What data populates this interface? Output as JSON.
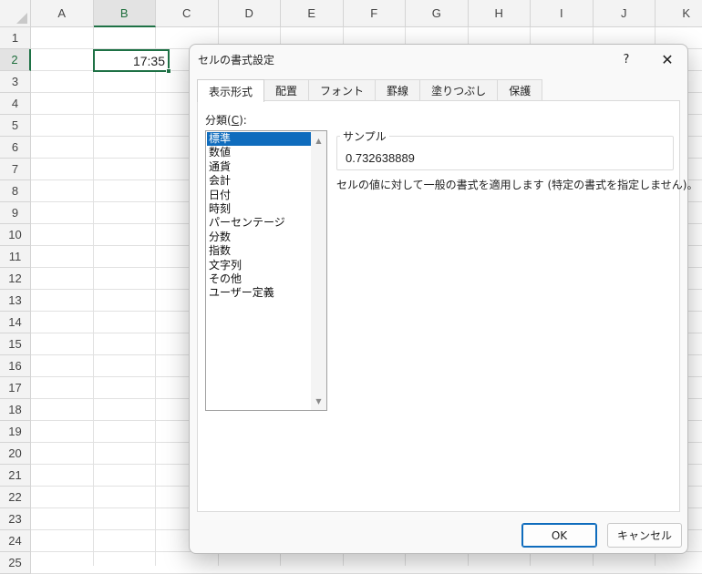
{
  "sheet": {
    "columns": [
      "A",
      "B",
      "C",
      "D",
      "E",
      "F",
      "G",
      "H",
      "I",
      "J",
      "K"
    ],
    "rows": [
      "1",
      "2",
      "3",
      "4",
      "5",
      "6",
      "7",
      "8",
      "9",
      "10",
      "11",
      "12",
      "13",
      "14",
      "15",
      "16",
      "17",
      "18",
      "19",
      "20",
      "21",
      "22",
      "23",
      "24",
      "25"
    ],
    "active_cell_value": "17:35",
    "accent_color": "#1e7145"
  },
  "dialog": {
    "title": "セルの書式設定",
    "help_label": "?",
    "close_label": "✕",
    "tabs": [
      "表示形式",
      "配置",
      "フォント",
      "罫線",
      "塗りつぶし",
      "保護"
    ],
    "active_tab": "表示形式",
    "category_label_prefix": "分類(",
    "category_label_key": "C",
    "category_label_suffix": "):",
    "categories": [
      "標準",
      "数値",
      "通貨",
      "会計",
      "日付",
      "時刻",
      "パーセンテージ",
      "分数",
      "指数",
      "文字列",
      "その他",
      "ユーザー定義"
    ],
    "selected_category": "標準",
    "sample_legend": "サンプル",
    "sample_value": "0.732638889",
    "description": "セルの値に対して一般の書式を適用します (特定の書式を指定しません)。",
    "ok_label": "OK",
    "cancel_label": "キャンセル",
    "select_color": "#0f6cbd"
  }
}
